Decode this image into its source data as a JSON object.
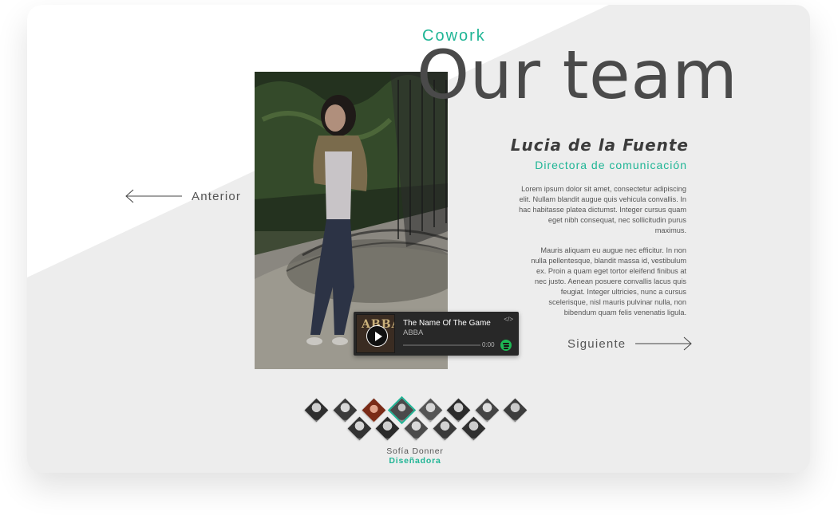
{
  "header": {
    "eyebrow": "Cowork",
    "title": "Our team"
  },
  "navigation": {
    "prev_label": "Anterior",
    "next_label": "Siguiente"
  },
  "member": {
    "name": "Lucia de la Fuente",
    "role": "Directora de comunicación",
    "bio": [
      "Lorem ipsum dolor sit amet, consectetur adipiscing elit. Nullam blandit augue quis vehicula convallis. In hac habitasse platea dictumst. Integer cursus quam eget nibh consequat, nec sollicitudin purus maximus.",
      "Mauris aliquam eu augue nec efficitur. In non nulla pellentesque, blandit massa id, vestibulum ex. Proin a quam eget tortor eleifend finibus at nec justo. Aenean posuere convallis lacus quis feugiat. Integer ultricies, nunc a cursus scelerisque, nisl mauris pulvinar nulla, non bibendum quam felis venenatis ligula."
    ]
  },
  "player": {
    "track": "The Name Of The Game",
    "artist": "ABBA",
    "cover_text": "ABBA",
    "time": "0:00",
    "progress": 0,
    "embed_icon": "</>"
  },
  "selected": {
    "name": "Sofía Donner",
    "role": "Diseñadora"
  },
  "colors": {
    "accent": "#1fb595",
    "card_bg": "#ededed",
    "title": "#4a4a4a",
    "player_bg": "#282828",
    "spotify": "#1db954"
  },
  "icons": {
    "prev": "arrow-left-icon",
    "next": "arrow-right-icon",
    "play": "play-icon",
    "embed": "embed-code-icon",
    "spotify": "spotify-icon"
  }
}
